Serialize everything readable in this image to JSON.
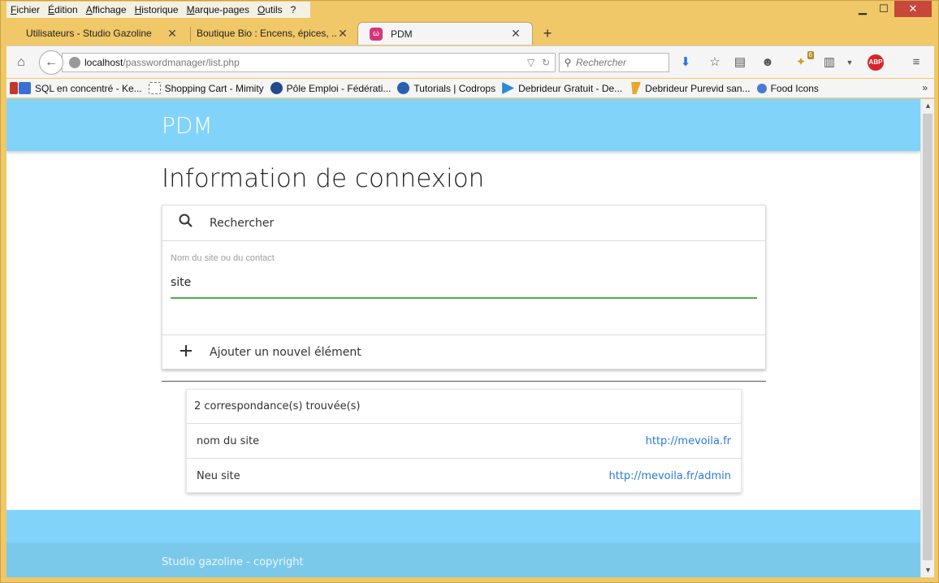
{
  "menubar": {
    "items": [
      "Fichier",
      "Édition",
      "Affichage",
      "Historique",
      "Marque-pages",
      "Outils",
      "?"
    ]
  },
  "window_controls": {
    "minimize": "▁",
    "maximize": "☐",
    "close": "✕"
  },
  "tabs": [
    {
      "label": "Utilisateurs - Studio Gazoline",
      "close": "✕"
    },
    {
      "label": "Boutique Bio : Encens, épices, ...",
      "close": "✕"
    },
    {
      "label": "PDM",
      "close": "✕"
    }
  ],
  "new_tab": "+",
  "navbar": {
    "url_host": "localhost",
    "url_path": "/passwordmanager/list.php",
    "search_placeholder": "Rechercher",
    "addon_badge": "6",
    "abp_label": "ABP"
  },
  "bookmarks": [
    {
      "label": "SQL en concentré - Ke...",
      "color": "#3b6fd6"
    },
    {
      "label": "Shopping Cart - Mimity",
      "color": "#ffffff"
    },
    {
      "label": "Pôle Emploi - Fédérati...",
      "color": "#234a8a"
    },
    {
      "label": "Tutorials | Codrops",
      "color": "#2b5fb0"
    },
    {
      "label": "Debrideur Gratuit - De...",
      "color": "#2b8ad6"
    },
    {
      "label": "Debrideur Purevid san...",
      "color": "#e8a828"
    },
    {
      "label": "Food Icons",
      "color": "#4a7ad0"
    }
  ],
  "page": {
    "brand": "PDM",
    "title": "Information de connexion",
    "search_header": "Rechercher",
    "field_label": "Nom du site ou du contact",
    "field_value": "site",
    "add_label": "Ajouter un nouvel élément",
    "results_header": "2 correspondance(s) trouvée(s)",
    "results": [
      {
        "name": "nom du site",
        "url": "http://mevoila.fr"
      },
      {
        "name": "Neu site",
        "url": "http://mevoila.fr/admin"
      }
    ],
    "footer_text": "Studio gazoline - copyright"
  },
  "colors": {
    "header_bg": "#81d3f9",
    "footer_copy_bg": "#7bc9ea",
    "input_underline": "#4caf50",
    "link": "#2a7ad6",
    "frame": "#f0c868"
  }
}
